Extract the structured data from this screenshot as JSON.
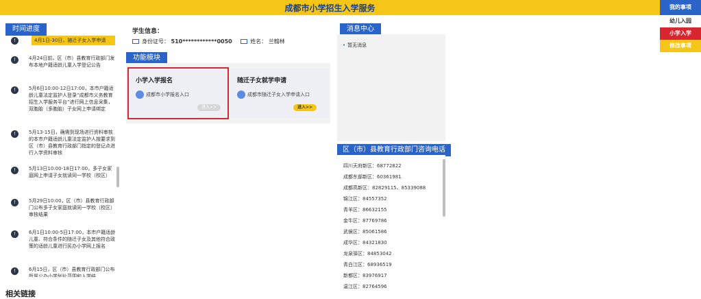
{
  "header": {
    "title": "成都市小学招生入学服务"
  },
  "right_menu": {
    "title": "我的事项",
    "items": [
      "幼儿入园",
      "小学入学",
      "修改事项"
    ]
  },
  "timeline": {
    "tab": "时间进度",
    "items": [
      "4月1日-30日，随迁子女入学申请",
      "4月24日前，区（市）县教育行政部门发布本地户籍适龄儿童入学登记公告",
      "5月6日10:00-12日17:00，本市户籍适龄儿童法定监护人登录“成都市义务教育招生入学服务平台”进行网上信息采集，双胞胎（多胞胎）子女网上申请绑定",
      "5月13-15日，确需到现场进行资料审核的本市户籍适龄儿童法定监护人按要求到区（市）县教育行政部门指定的登记点进行入学资料审核",
      "5月13日10:00-18日17:00，多子女家庭网上申请子女就读同一学校（校区）",
      "5月29日10:00，区（市）县教育行政部门公布多子女家庭就读同一学校（校区）审核结果",
      "6月1日10:00-5日17:00，本市户籍适龄儿童、符合条件的随迁子女及其他符合政策的适龄儿童进行民办小学网上报名",
      "6月15日，区（市）县教育行政部门公布所属公办小学划片范围和入学结"
    ]
  },
  "student": {
    "label": "学生信息：",
    "id_label": "身份证号：",
    "id_value": "510************0050",
    "name_label": "姓名：",
    "name_value": "兰翰林"
  },
  "modules": {
    "tab": "功能模块",
    "cards": [
      {
        "title": "小学入学报名",
        "desc": "成都市小学报名入口",
        "button": "进入>>"
      },
      {
        "title": "随迁子女就学申请",
        "desc": "成都市随迁子女入学申请入口",
        "button": "进入>>"
      }
    ]
  },
  "messages": {
    "tab": "消息中心",
    "empty": "暂无消息"
  },
  "phones": {
    "tab": "区（市）县教育行政部门咨询电话",
    "items": [
      "四川天府新区：68772822",
      "成都东部新区：60361981",
      "成都高新区：82829115、85339088",
      "锦江区：84557352",
      "青羊区：86632155",
      "金牛区：87769786",
      "武侯区：85061586",
      "成华区：84321830",
      "龙泉驿区：84853042",
      "青白江区：68936519",
      "新都区：83976917",
      "温江区：82764596"
    ]
  },
  "footer": {
    "related": "相关链接"
  },
  "colors": {
    "accent": "#2a64c9",
    "header_bg": "#f5c518",
    "highlight": "#d7262e"
  }
}
